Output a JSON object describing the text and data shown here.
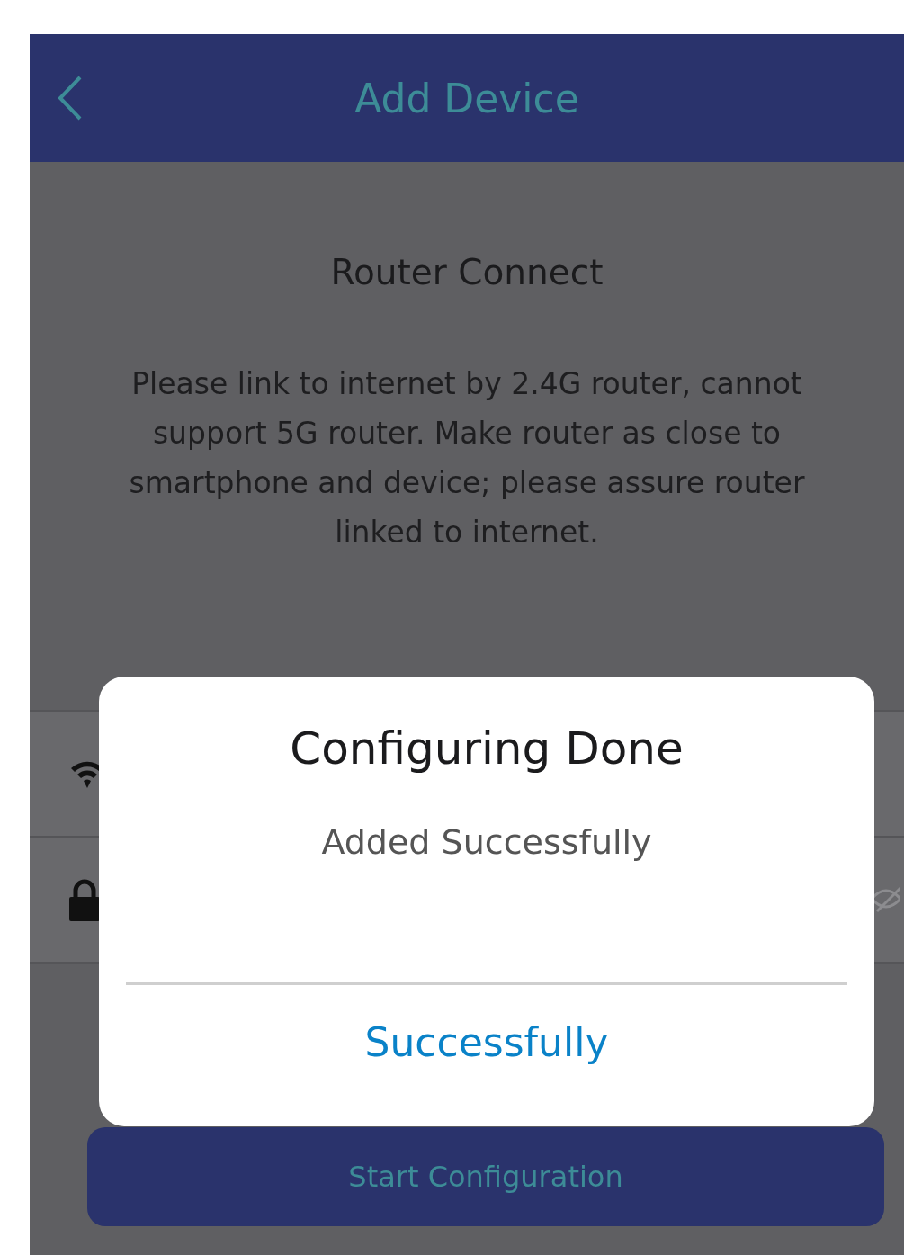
{
  "header": {
    "title": "Add Device"
  },
  "content": {
    "heading": "Router Connect",
    "message": "Please link to internet by 2.4G router, cannot support 5G router. Make router as close to smartphone and device; please assure router linked to internet."
  },
  "fields": [
    {
      "kind": "wifi"
    },
    {
      "kind": "password"
    }
  ],
  "button": {
    "label": "Start Configuration"
  },
  "dialog": {
    "title": "Configuring Done",
    "message": "Added Successfully",
    "action": "Successfully"
  }
}
